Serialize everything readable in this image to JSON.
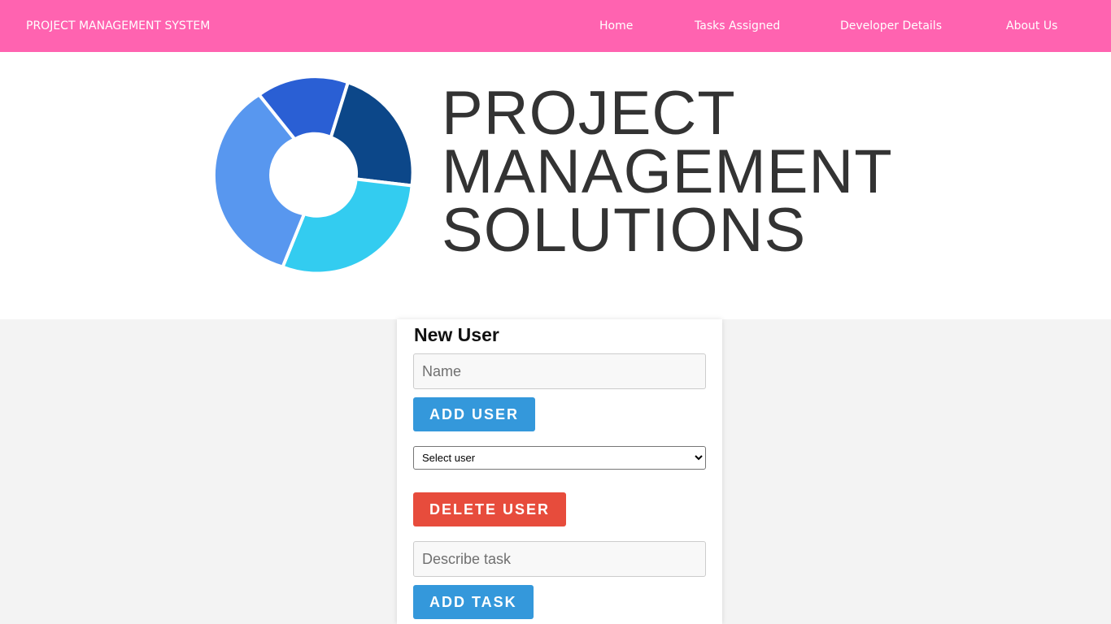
{
  "navbar": {
    "brand": "PROJECT MANAGEMENT SYSTEM",
    "links": [
      "Home",
      "Tasks Assigned",
      "Developer Details",
      "About Us"
    ],
    "background_color": "#ff63b0"
  },
  "banner": {
    "logo_lines": [
      "PROJECT",
      "MANAGEMENT",
      "SOLUTIONS"
    ],
    "logo_icon": "donut-chart-logo",
    "logo_colors": [
      "#2a5fd4",
      "#0c4789",
      "#33ccf0",
      "#5897ef"
    ]
  },
  "form": {
    "title": "New User",
    "name_placeholder": "Name",
    "add_user_label": "ADD USER",
    "user_select_value": "Select user",
    "delete_user_label": "DELETE USER",
    "task_placeholder": "Describe task",
    "add_task_label": "ADD TASK"
  },
  "colors": {
    "primary_button": "#3498db",
    "danger_button": "#e74c3c"
  }
}
